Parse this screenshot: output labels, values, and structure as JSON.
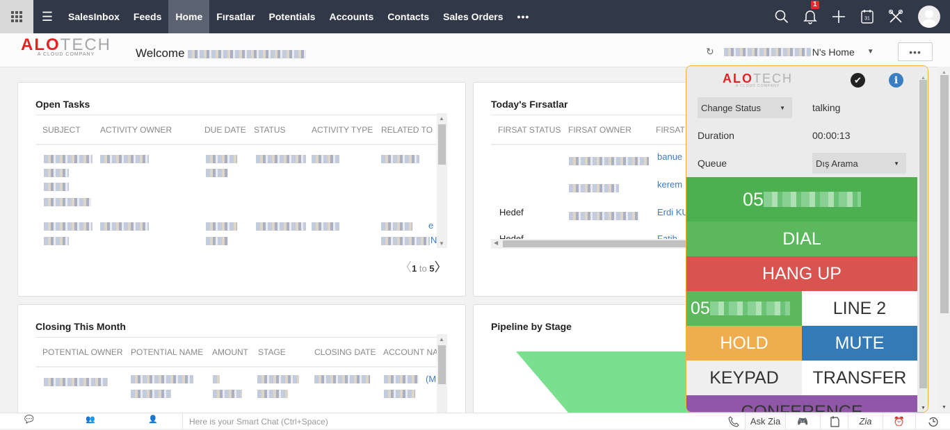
{
  "topbar": {
    "nav": [
      "SalesInbox",
      "Feeds",
      "Home",
      "Fırsatlar",
      "Potentials",
      "Accounts",
      "Contacts",
      "Sales Orders"
    ],
    "active": "Home",
    "more_label": "•••",
    "notification_count": "1",
    "calendar_day": "31",
    "icons": [
      "apps-grid-icon",
      "menu-icon",
      "search-icon",
      "bell-icon",
      "plus-icon",
      "calendar-icon",
      "tools-icon",
      "avatar"
    ]
  },
  "header": {
    "logo_a": "ALO",
    "logo_b": "TECH",
    "logo_sub": "A CLOUD COMPANY",
    "welcome": "Welcome",
    "home_suffix": "N's Home",
    "more": "•••"
  },
  "open_tasks": {
    "title": "Open Tasks",
    "columns": [
      "SUBJECT",
      "ACTIVITY OWNER",
      "DUE DATE",
      "STATUS",
      "ACTIVITY TYPE",
      "RELATED TO"
    ],
    "related_partial": [
      "",
      "e",
      "N"
    ],
    "pager": {
      "from": "1",
      "to_label": "to",
      "to": "5"
    }
  },
  "firsatlar": {
    "title": "Today's Fırsatlar",
    "columns": [
      "FIRSAT STATUS",
      "FIRSAT OWNER",
      "FIRSAT"
    ],
    "rows": [
      {
        "status": "",
        "name": "banue"
      },
      {
        "status": "",
        "name": "kerem"
      },
      {
        "status": "Hedef",
        "name": "Erdi KU"
      },
      {
        "status": "Hedef",
        "name": "Fatih"
      }
    ]
  },
  "closing": {
    "title": "Closing This Month",
    "columns": [
      "POTENTIAL OWNER",
      "POTENTIAL NAME",
      "AMOUNT",
      "STAGE",
      "CLOSING DATE",
      "ACCOUNT NA"
    ],
    "account_partial": "(M"
  },
  "pipeline": {
    "title": "Pipeline by Stage",
    "funnel_color": "#7ae090"
  },
  "phone": {
    "logo_a": "ALO",
    "logo_b": "TECH",
    "logo_sub": "A CLOUD COMPANY",
    "status_select": "Change Status",
    "status_value": "talking",
    "duration_label": "Duration",
    "duration_value": "00:00:13",
    "queue_label": "Queue",
    "queue_value": "Dış Arama",
    "number_prefix": "05",
    "line1_prefix": "05",
    "buttons": {
      "dial": "DIAL",
      "hangup": "HANG UP",
      "line2": "LINE 2",
      "hold": "HOLD",
      "mute": "MUTE",
      "keypad": "KEYPAD",
      "transfer": "TRANSFER",
      "conference": "CONFERENCE"
    },
    "colors": {
      "green": "#4caf50",
      "dial": "#5cb85c",
      "hangup": "#d9534f",
      "hold": "#f0ad4e",
      "mute": "#337ab7",
      "conference": "#9057a8",
      "border": "#f0b43a"
    }
  },
  "bottombar": {
    "left": [
      "Chats",
      "Channels",
      "Contacts"
    ],
    "smart_chat": "Here is your Smart Chat (Ctrl+Space)",
    "ask_zia": "Ask Zia",
    "zia": "Zia"
  }
}
